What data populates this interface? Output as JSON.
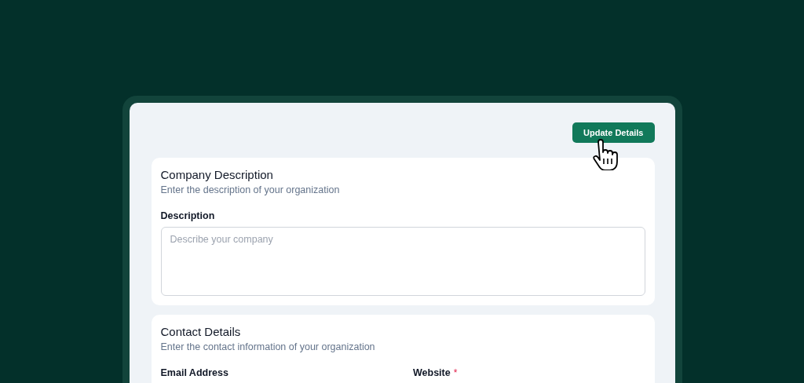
{
  "action_button": {
    "label": "Update Details"
  },
  "sections": [
    {
      "title": "Company Description",
      "subtitle": "Enter the description of your organization",
      "fields": [
        {
          "kind": "textarea",
          "label": "Description",
          "placeholder": "Describe your company"
        }
      ]
    },
    {
      "title": "Contact Details",
      "subtitle": "Enter the contact information of your organization",
      "fields": [
        {
          "label": "Email Address"
        },
        {
          "label": "Website",
          "required_mark": "*"
        }
      ]
    }
  ]
}
